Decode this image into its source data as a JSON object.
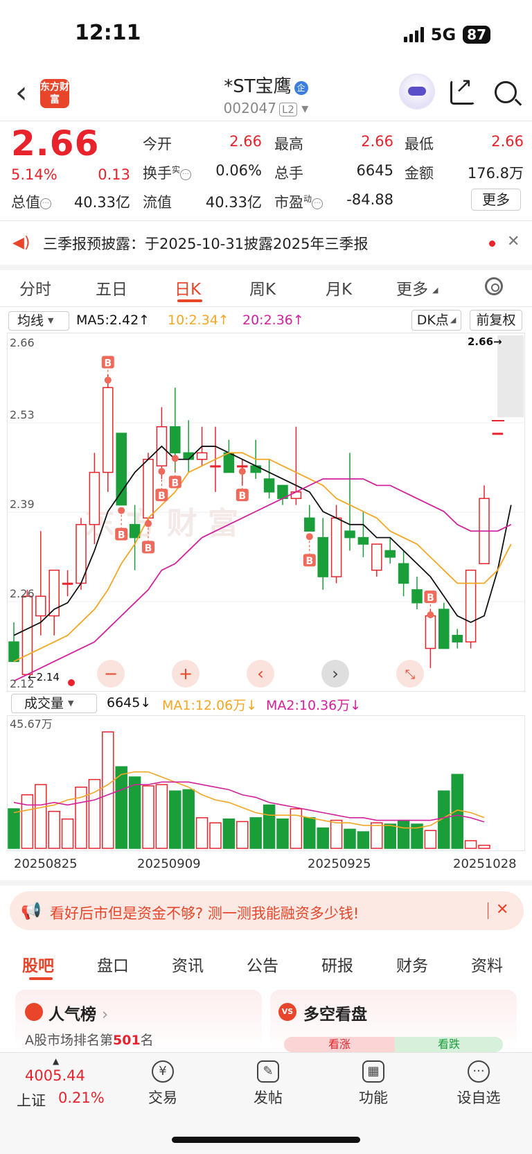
{
  "status": {
    "time": "12:11",
    "network": "5G",
    "battery": "87"
  },
  "header": {
    "logo": "东方财富",
    "name": "*ST宝鹰",
    "badge": "企",
    "code": "002047",
    "level": "L2"
  },
  "quote": {
    "price": "2.66",
    "pct": "5.14%",
    "chg": "0.13",
    "open_label": "今开",
    "open": "2.66",
    "high_label": "最高",
    "high": "2.66",
    "low_label": "最低",
    "low": "2.66",
    "turnover_label": "换手",
    "turnover_sup": "实",
    "turnover": "0.06%",
    "vol_label": "总手",
    "vol": "6645",
    "amount_label": "金额",
    "amount": "176.8万",
    "mktcap_label": "总值",
    "mktcap": "40.33亿",
    "float_label": "流值",
    "float": "40.33亿",
    "pe_label": "市盈",
    "pe_sup": "动",
    "pe": "-84.88",
    "more": "更多"
  },
  "notice": {
    "text": "三季报预披露：于2025-10-31披露2025年三季报",
    "close": "✕"
  },
  "ktabs": [
    "分时",
    "五日",
    "日K",
    "周K",
    "月K",
    "更多"
  ],
  "ma": {
    "select": "均线",
    "ma5": "MA5:2.42↑",
    "ma10": "10:2.34↑",
    "ma20": "20:2.36↑",
    "dk": "DK点",
    "fq": "前复权"
  },
  "price_axis": {
    "top": "2.66",
    "l1": "2.53",
    "l2": "2.39",
    "l3": "2.26",
    "bottom": "2.12",
    "last_tag": "2.66→",
    "low_tag": "←2.14"
  },
  "volume": {
    "select": "成交量",
    "vol": "6645↓",
    "ma1": "MA1:12.06万↓",
    "ma2": "MA2:10.36万↓",
    "max": "45.67万"
  },
  "dates": [
    "20250825",
    "20250909",
    "20250925",
    "20251028"
  ],
  "promo": {
    "text": "看好后市但是资金不够? 测一测我能融资多少钱!",
    "close": "✕"
  },
  "btabs": [
    "股吧",
    "盘口",
    "资讯",
    "公告",
    "研报",
    "财务",
    "资料"
  ],
  "cards": {
    "rank_title": "人气榜",
    "rank_prefix": "A股市场排名第",
    "rank_num": "501",
    "rank_suffix": "名",
    "vs_title": "多空看盘",
    "vs": "VS",
    "up": "看涨",
    "down": "看跌"
  },
  "nav": {
    "index_val": "4005.44",
    "index_name": "上证",
    "index_pct": "0.21%",
    "trade": "交易",
    "post": "发帖",
    "func": "功能",
    "watch": "设自选"
  },
  "colors": {
    "up": "#e8232c",
    "down": "#1a9e3a",
    "accent": "#e8452a",
    "ma5": "#111111",
    "ma10": "#f5a623",
    "ma20": "#d3219b"
  },
  "chart_data": {
    "type": "candlestick",
    "ylim": [
      2.12,
      2.66
    ],
    "candles": [
      {
        "o": 2.19,
        "h": 2.22,
        "l": 2.16,
        "c": 2.16
      },
      {
        "o": 2.14,
        "h": 2.27,
        "l": 2.14,
        "c": 2.26
      },
      {
        "o": 2.23,
        "h": 2.36,
        "l": 2.2,
        "c": 2.26
      },
      {
        "o": 2.23,
        "h": 2.29,
        "l": 2.2,
        "c": 2.3
      },
      {
        "o": 2.28,
        "h": 2.3,
        "l": 2.26,
        "c": 2.28
      },
      {
        "o": 2.28,
        "h": 2.38,
        "l": 2.27,
        "c": 2.37
      },
      {
        "o": 2.37,
        "h": 2.48,
        "l": 2.34,
        "c": 2.45
      },
      {
        "o": 2.45,
        "h": 2.6,
        "l": 2.42,
        "c": 2.58
      },
      {
        "o": 2.51,
        "h": 2.51,
        "l": 2.4,
        "c": 2.4
      },
      {
        "o": 2.37,
        "h": 2.4,
        "l": 2.3,
        "c": 2.35
      },
      {
        "o": 2.38,
        "h": 2.48,
        "l": 2.37,
        "c": 2.47
      },
      {
        "o": 2.46,
        "h": 2.55,
        "l": 2.44,
        "c": 2.52
      },
      {
        "o": 2.52,
        "h": 2.58,
        "l": 2.45,
        "c": 2.48
      },
      {
        "o": 2.48,
        "h": 2.53,
        "l": 2.45,
        "c": 2.47
      },
      {
        "o": 2.47,
        "h": 2.52,
        "l": 2.46,
        "c": 2.48
      },
      {
        "o": 2.46,
        "h": 2.52,
        "l": 2.42,
        "c": 2.46
      },
      {
        "o": 2.48,
        "h": 2.5,
        "l": 2.45,
        "c": 2.45
      },
      {
        "o": 2.46,
        "h": 2.47,
        "l": 2.43,
        "c": 2.46
      },
      {
        "o": 2.46,
        "h": 2.5,
        "l": 2.44,
        "c": 2.45
      },
      {
        "o": 2.44,
        "h": 2.47,
        "l": 2.41,
        "c": 2.42
      },
      {
        "o": 2.43,
        "h": 2.43,
        "l": 2.4,
        "c": 2.41
      },
      {
        "o": 2.41,
        "h": 2.52,
        "l": 2.4,
        "c": 2.42
      },
      {
        "o": 2.38,
        "h": 2.4,
        "l": 2.36,
        "c": 2.36
      },
      {
        "o": 2.35,
        "h": 2.38,
        "l": 2.27,
        "c": 2.29
      },
      {
        "o": 2.29,
        "h": 2.4,
        "l": 2.28,
        "c": 2.38
      },
      {
        "o": 2.36,
        "h": 2.48,
        "l": 2.33,
        "c": 2.35
      },
      {
        "o": 2.35,
        "h": 2.39,
        "l": 2.32,
        "c": 2.34
      },
      {
        "o": 2.3,
        "h": 2.34,
        "l": 2.29,
        "c": 2.34
      },
      {
        "o": 2.33,
        "h": 2.35,
        "l": 2.31,
        "c": 2.32
      },
      {
        "o": 2.31,
        "h": 2.33,
        "l": 2.26,
        "c": 2.28
      },
      {
        "o": 2.27,
        "h": 2.29,
        "l": 2.24,
        "c": 2.25
      },
      {
        "o": 2.18,
        "h": 2.24,
        "l": 2.15,
        "c": 2.23
      },
      {
        "o": 2.24,
        "h": 2.25,
        "l": 2.19,
        "c": 2.18
      },
      {
        "o": 2.2,
        "h": 2.21,
        "l": 2.18,
        "c": 2.19
      },
      {
        "o": 2.19,
        "h": 2.3,
        "l": 2.18,
        "c": 2.3
      },
      {
        "o": 2.31,
        "h": 2.43,
        "l": 2.31,
        "c": 2.41
      },
      {
        "o": 2.51,
        "h": 2.51,
        "l": 2.51,
        "c": 2.51
      }
    ],
    "ma5": [
      2.2,
      2.21,
      2.22,
      2.24,
      2.25,
      2.28,
      2.33,
      2.39,
      2.42,
      2.45,
      2.47,
      2.49,
      2.47,
      2.47,
      2.49,
      2.49,
      2.48,
      2.47,
      2.46,
      2.45,
      2.44,
      2.43,
      2.42,
      2.39,
      2.38,
      2.37,
      2.37,
      2.35,
      2.35,
      2.33,
      2.31,
      2.29,
      2.26,
      2.23,
      2.22,
      2.23,
      2.3,
      2.4
    ],
    "ma10": [
      2.16,
      2.17,
      2.18,
      2.19,
      2.2,
      2.22,
      2.24,
      2.27,
      2.31,
      2.34,
      2.38,
      2.4,
      2.42,
      2.45,
      2.46,
      2.47,
      2.48,
      2.48,
      2.47,
      2.47,
      2.46,
      2.45,
      2.44,
      2.43,
      2.41,
      2.4,
      2.39,
      2.38,
      2.36,
      2.35,
      2.34,
      2.32,
      2.3,
      2.28,
      2.28,
      2.28,
      2.3,
      2.34
    ],
    "ma20": [
      2.13,
      2.14,
      2.15,
      2.16,
      2.17,
      2.18,
      2.19,
      2.21,
      2.23,
      2.25,
      2.27,
      2.3,
      2.31,
      2.33,
      2.35,
      2.36,
      2.37,
      2.38,
      2.39,
      2.4,
      2.41,
      2.42,
      2.43,
      2.44,
      2.44,
      2.44,
      2.44,
      2.43,
      2.43,
      2.42,
      2.41,
      2.4,
      2.39,
      2.37,
      2.36,
      2.36,
      2.36,
      2.37
    ],
    "volume": [
      15.5,
      21.0,
      25.0,
      14.5,
      11.5,
      24.0,
      27.0,
      45.67,
      32.0,
      28.0,
      24.5,
      25.0,
      22.5,
      23.0,
      12.0,
      10.0,
      11.5,
      10.5,
      12.0,
      17.0,
      11.5,
      15.5,
      12.0,
      8.0,
      11.0,
      7.5,
      6.5,
      10.0,
      9.5,
      11.0,
      9.5,
      7.0,
      22.5,
      29.0,
      3.0,
      1.2
    ],
    "vol_ma1": [
      14,
      15,
      16,
      17,
      19,
      20,
      22,
      25,
      29,
      30,
      30,
      28,
      26,
      24,
      21,
      19,
      18,
      16,
      14,
      13,
      13,
      13,
      12,
      11,
      10,
      10,
      9,
      9,
      9,
      8,
      8,
      9,
      12,
      15,
      14,
      12.06
    ],
    "vol_ma2": [
      18,
      17,
      17,
      18,
      17,
      18,
      19,
      21,
      23,
      25,
      25,
      26,
      26,
      26,
      25,
      24,
      23,
      21,
      20,
      18,
      17,
      16,
      15,
      14,
      13,
      12,
      12,
      11,
      11,
      11,
      11,
      11,
      12,
      13,
      12,
      10.36
    ]
  }
}
